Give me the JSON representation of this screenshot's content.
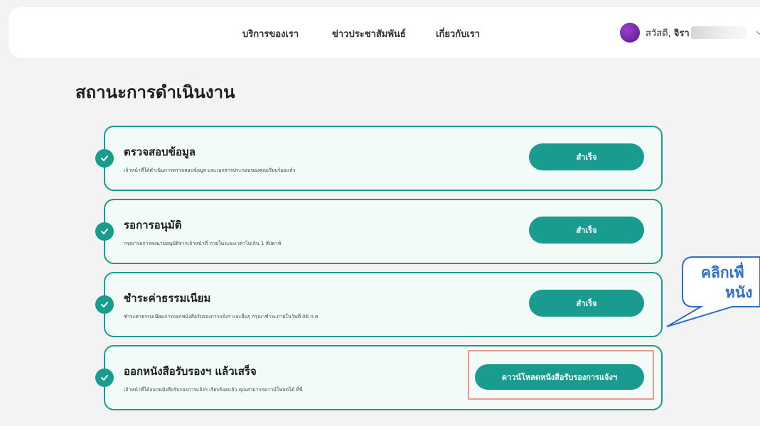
{
  "header": {
    "nav": [
      "บริการของเรา",
      "ข่าวประชาสัมพันธ์",
      "เกี่ยวกับเรา"
    ],
    "greeting": "สวัสดี,",
    "user_name": "จิรา"
  },
  "page": {
    "title": "สถานะการดำเนินงาน"
  },
  "steps": [
    {
      "title": "ตรวจสอบข้อมูล",
      "desc": "เจ้าหน้าที่ได้ดำเนินการตรวจสอบข้อมูล และเอกสารประกอบของคุณเรียบร้อยแล้ว",
      "button": "สำเร็จ"
    },
    {
      "title": "รอการอนุมัติ",
      "desc": "กรุณารอการลงนามอนุมัติจากเจ้าหน้าที่ ภายในระยะเวลาไม่เกิน 1 สัปดาห์",
      "button": "สำเร็จ"
    },
    {
      "title": "ชำระค่าธรรมเนียม",
      "desc": "ชำระค่าธรรมเนียมการออกหนังสือรับรองการแจ้งฯ และอื่นๆ กรุณาชำระภายในวันที่ 06 ก.ค",
      "button": "สำเร็จ"
    },
    {
      "title": "ออกหนังสือรับรองฯ แล้วเสร็จ",
      "desc": "เจ้าหน้าที่ได้ออกหนังสือรับรองการแจ้งฯ เรียบร้อยแล้ว คุณสามารถดาวน์โหลดได้ ที่นี่",
      "button": "ดาวน์โหลดหนังสือรับรองการแจ้งฯ"
    }
  ],
  "callout": {
    "line1": "คลิกเพื่",
    "line2": "หนัง"
  },
  "colors": {
    "accent": "#1a9b8f",
    "callout": "#2f6fcc",
    "highlight": "#ec9b8a"
  }
}
